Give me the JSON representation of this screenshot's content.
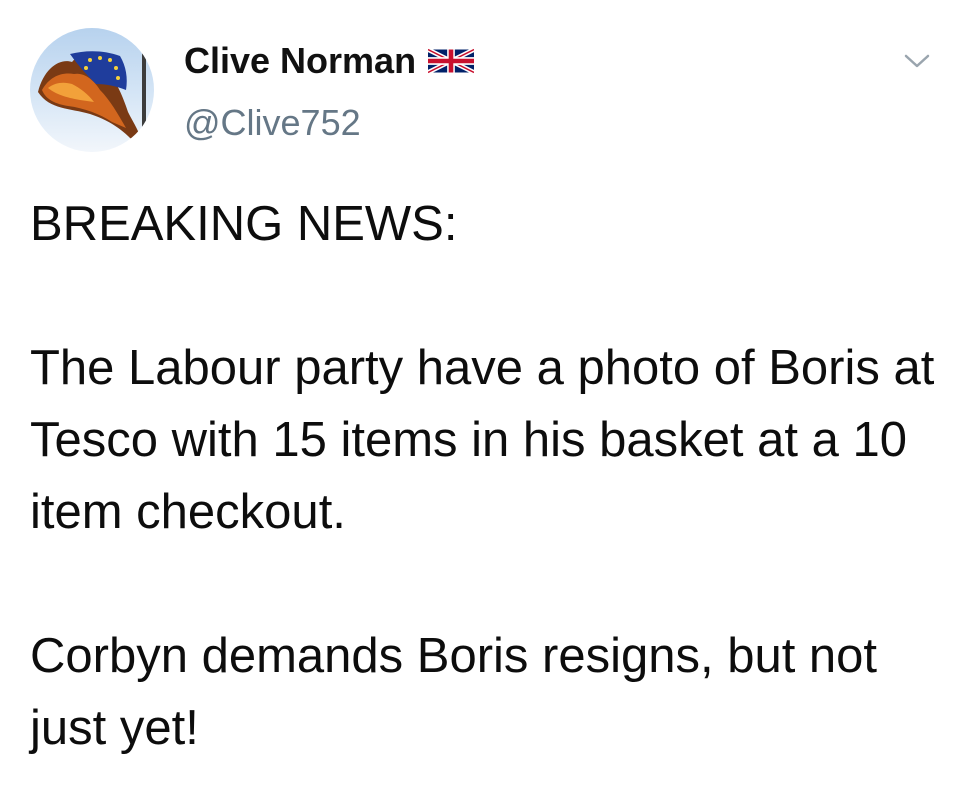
{
  "user": {
    "display_name": "Clive Norman",
    "handle": "@Clive752",
    "avatar_icon": "burning-eu-flag-avatar",
    "flag_icon": "uk-flag-icon"
  },
  "menu": {
    "caret_icon": "chevron-down-icon"
  },
  "tweet": {
    "text": "BREAKING NEWS:\n\nThe Labour party have a photo of Boris at Tesco with 15 items in his basket at a 10 item checkout.\n\nCorbyn demands Boris resigns, but not just yet!"
  },
  "colors": {
    "handle": "#657786",
    "link": "#1da1f2",
    "text": "#0d0d0d"
  }
}
